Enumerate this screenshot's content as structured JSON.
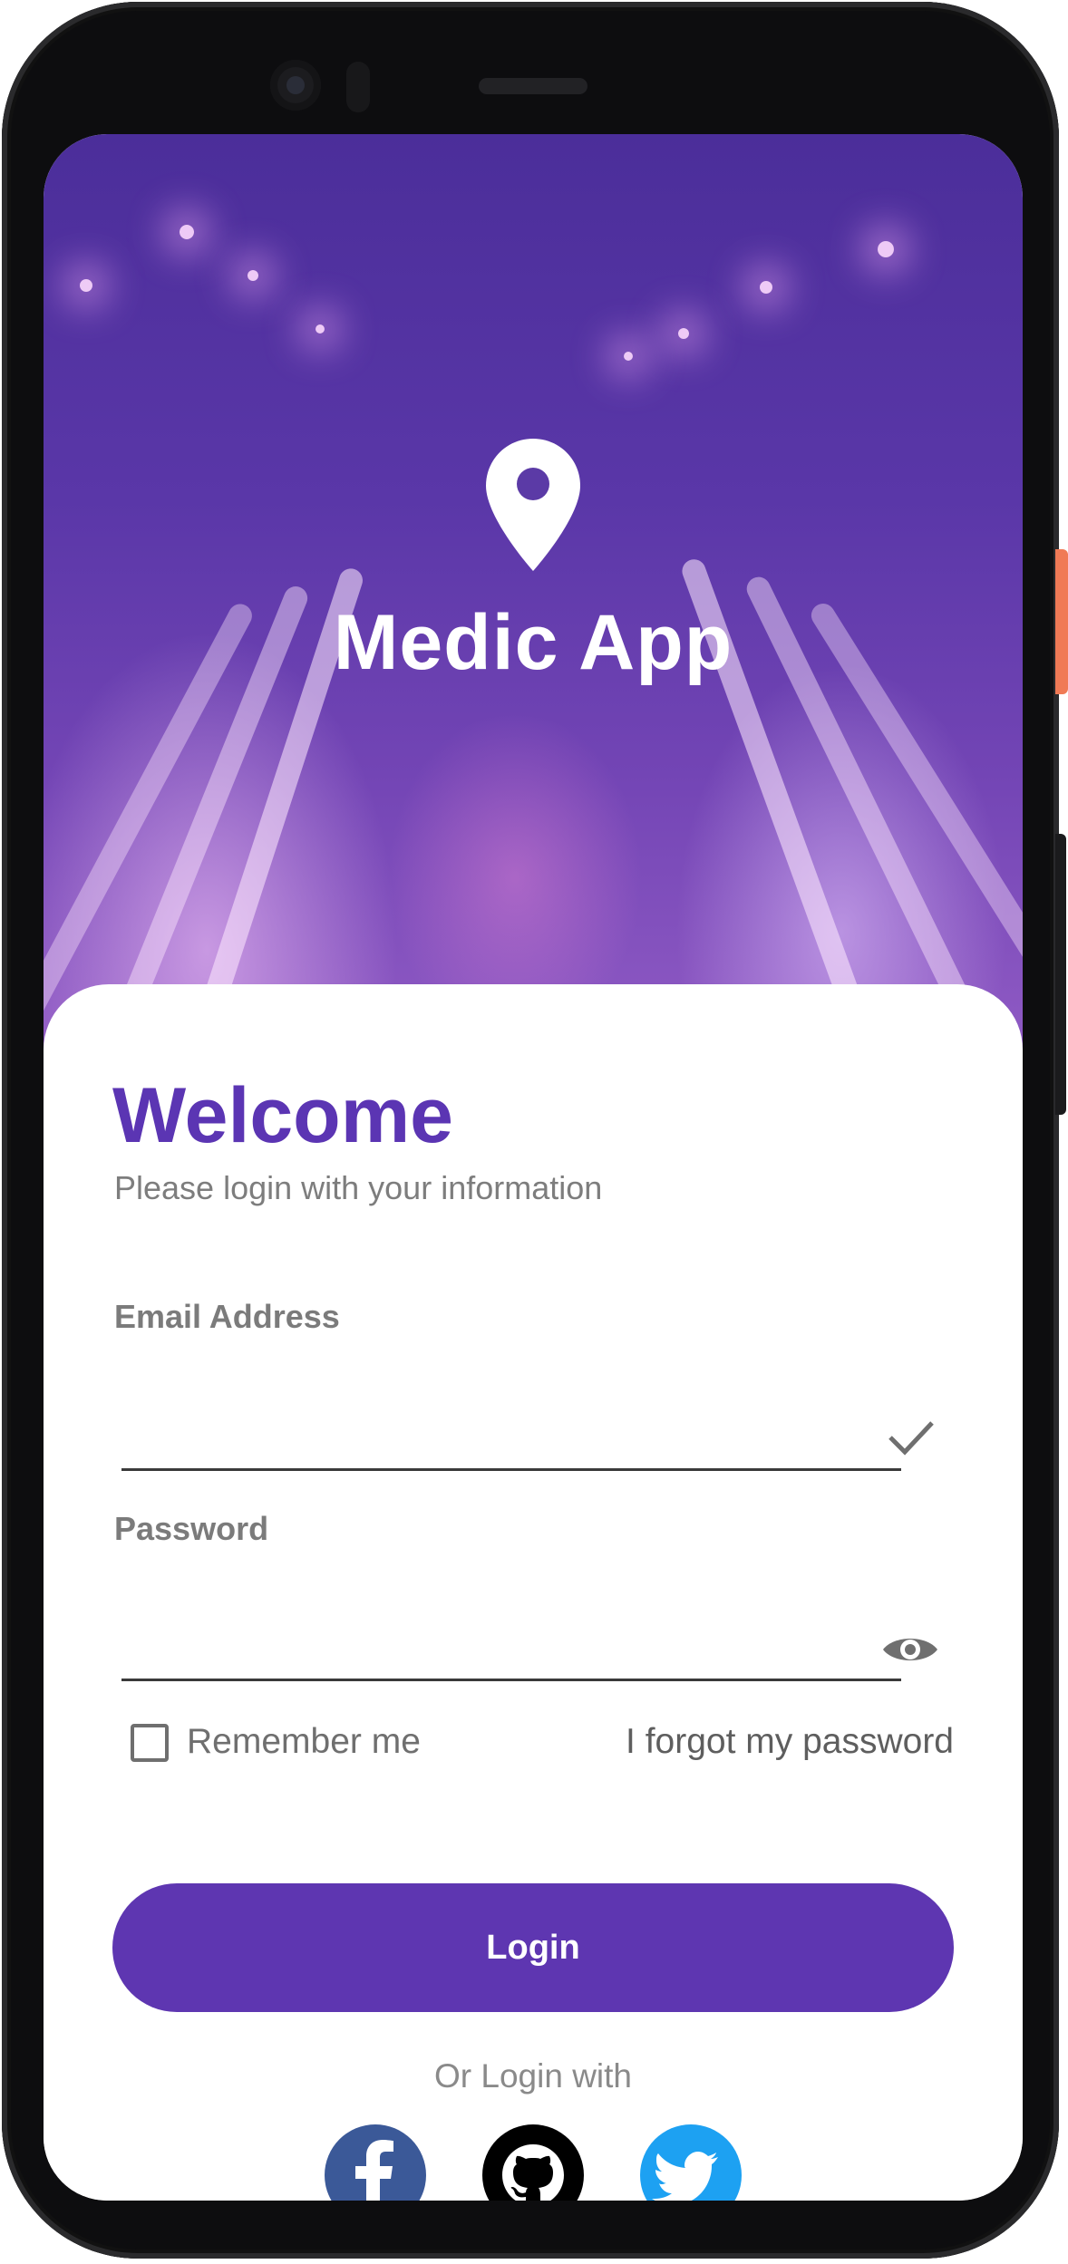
{
  "hero": {
    "app_name": "Medic App",
    "icon": "location-pin-icon"
  },
  "login": {
    "welcome_title": "Welcome",
    "subtitle": "Please login with your information",
    "email": {
      "label": "Email Address",
      "value": "",
      "placeholder": "",
      "trailing_icon": "check-icon"
    },
    "password": {
      "label": "Password",
      "value": "",
      "placeholder": "",
      "trailing_icon": "eye-icon"
    },
    "remember_me": {
      "label": "Remember me",
      "checked": false
    },
    "forgot_password": "I forgot my password",
    "login_button": "Login",
    "or_login_with": "Or Login with",
    "social": [
      {
        "name": "facebook",
        "icon": "facebook-icon",
        "color": "#3b5998"
      },
      {
        "name": "github",
        "icon": "github-icon",
        "color": "#000000"
      },
      {
        "name": "twitter",
        "icon": "twitter-icon",
        "color": "#1da1f2"
      }
    ]
  },
  "theme": {
    "primary": "#5e36b1",
    "label_gray": "#7b7b7b"
  }
}
